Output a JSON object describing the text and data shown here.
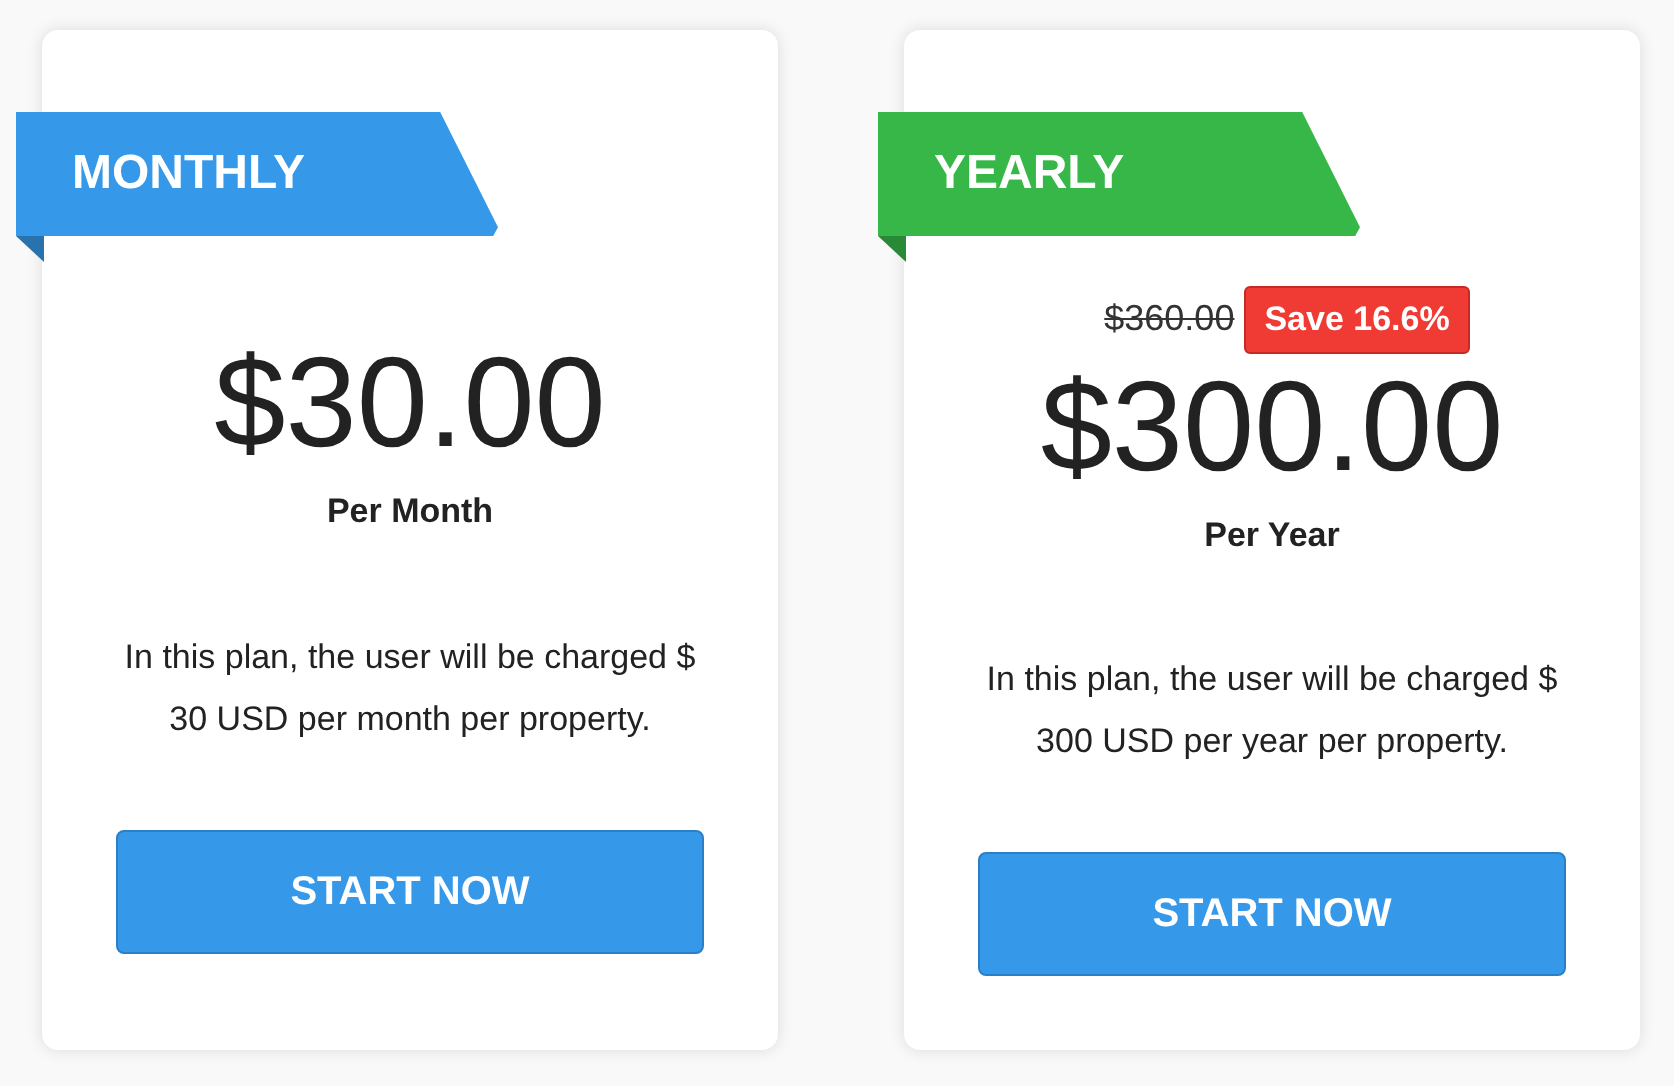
{
  "plans": [
    {
      "label": "MONTHLY",
      "color": "#3598e8",
      "price": "$30.00",
      "period": "Per Month",
      "description": "In this plan, the user will be charged $ 30 USD per month per property.",
      "button": "START NOW"
    },
    {
      "label": "YEARLY",
      "color": "#37b748",
      "original_price": "$360.00",
      "discount": "Save 16.6%",
      "price": "$300.00",
      "period": "Per Year",
      "description": "In this plan, the user will be charged $ 300 USD per year per property.",
      "button": "START NOW"
    }
  ]
}
